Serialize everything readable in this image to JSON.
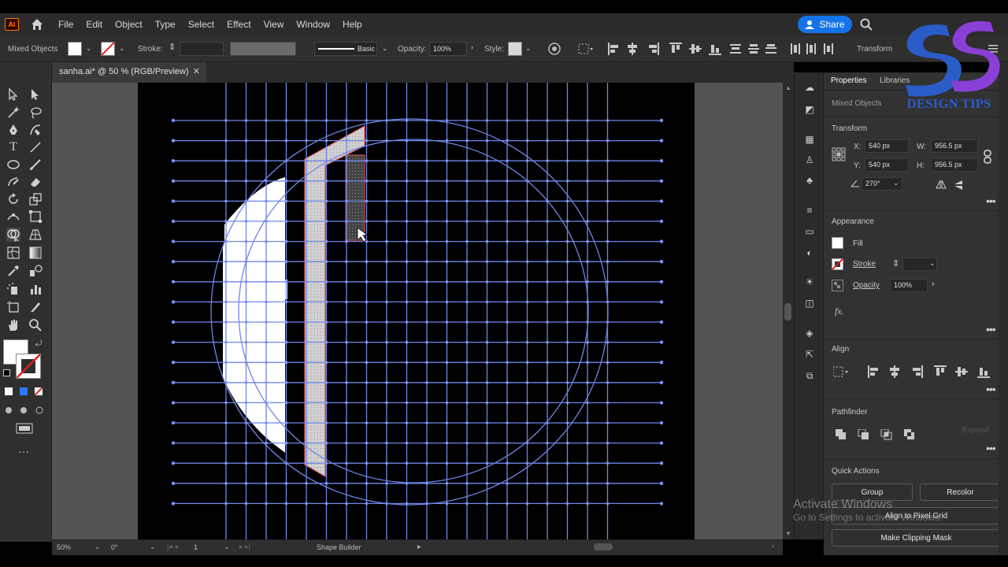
{
  "menubar": {
    "items": [
      "File",
      "Edit",
      "Object",
      "Type",
      "Select",
      "Effect",
      "View",
      "Window",
      "Help"
    ],
    "share_label": "Share"
  },
  "controlbar": {
    "selection_label": "Mixed Objects",
    "stroke_label": "Stroke:",
    "brush_label": "Basic",
    "opacity_label": "Opacity:",
    "opacity_value": "100%",
    "style_label": "Style:",
    "transform_label": "Transform"
  },
  "document": {
    "tab_title": "sanha.ai* @ 50 % (RGB/Preview)"
  },
  "statusbar": {
    "zoom": "50%",
    "rotation": "0°",
    "artboard": "1",
    "tool_name": "Shape Builder"
  },
  "properties": {
    "tab_properties": "Properties",
    "tab_libraries": "Libraries",
    "selection": "Mixed Objects",
    "transform": {
      "heading": "Transform",
      "x_label": "X:",
      "x": "540 px",
      "y_label": "Y:",
      "y": "540 px",
      "w_label": "W:",
      "w": "956.5 px",
      "h_label": "H:",
      "h": "956.5 px",
      "angle": "270°"
    },
    "appearance": {
      "heading": "Appearance",
      "fill": "Fill",
      "stroke": "Stroke",
      "opacity": "Opacity",
      "opacity_value": "100%",
      "fx": "fx."
    },
    "align": {
      "heading": "Align"
    },
    "pathfinder": {
      "heading": "Pathfinder",
      "expand": "Expand"
    },
    "quick_actions": {
      "heading": "Quick Actions",
      "group": "Group",
      "recolor": "Recolor",
      "align_pixel": "Align to Pixel Grid",
      "clipping_mask": "Make Clipping Mask"
    }
  },
  "watermark": {
    "line1": "Activate Windows",
    "line2": "Go to Settings to activate Windows."
  },
  "logo": {
    "text": "DESIGN TIPS"
  },
  "colors": {
    "accent": "#1473e6",
    "guide": "#6f86e8",
    "selection": "#e05a5a",
    "logo_blue": "#2a5cc8",
    "logo_purple": "#8a3fd6"
  }
}
